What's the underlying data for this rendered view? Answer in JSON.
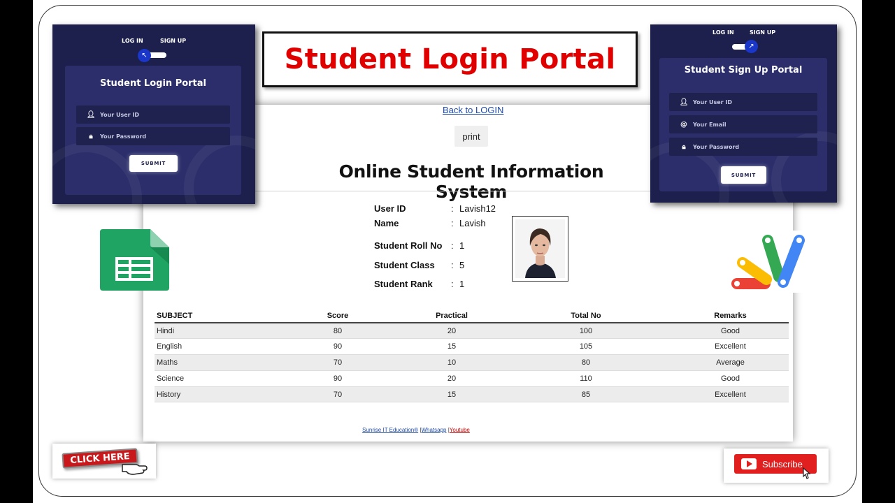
{
  "banner": {
    "title": "Student Login Portal"
  },
  "page": {
    "back_link": "Back to LOGIN",
    "print_label": "print",
    "system_title": "Online Student Information System"
  },
  "student": {
    "fields": [
      {
        "label": "User ID",
        "value": "Lavish12"
      },
      {
        "label": "Name",
        "value": "Lavish"
      },
      {
        "label": "Student Roll No",
        "value": "1"
      },
      {
        "label": "Student Class",
        "value": "5"
      },
      {
        "label": "Student Rank",
        "value": "1"
      }
    ],
    "colon": ":"
  },
  "grades": {
    "headers": [
      "SUBJECT",
      "Score",
      "Practical",
      "Total No",
      "Remarks"
    ],
    "rows": [
      [
        "Hindi",
        "80",
        "20",
        "100",
        "Good"
      ],
      [
        "English",
        "90",
        "15",
        "105",
        "Excellent"
      ],
      [
        "Maths",
        "70",
        "10",
        "80",
        "Average"
      ],
      [
        "Science",
        "90",
        "20",
        "110",
        "Good"
      ],
      [
        "History",
        "70",
        "15",
        "85",
        "Excellent"
      ]
    ]
  },
  "footer": {
    "link1": "Sunrise IT Education®",
    "link2": "Whatsapp",
    "link3": "Youtube",
    "sep": "|"
  },
  "login_card": {
    "tab_login": "LOG IN",
    "tab_signup": "SIGN UP",
    "title": "Student Login Portal",
    "user_placeholder": "Your User ID",
    "password_placeholder": "Your Password",
    "submit": "SUBMIT",
    "knob_arrow": "↖"
  },
  "signup_card": {
    "tab_login": "LOG IN",
    "tab_signup": "SIGN UP",
    "title": "Student Sign Up Portal",
    "user_placeholder": "Your User ID",
    "email_placeholder": "Your Email",
    "password_placeholder": "Your Password",
    "submit": "SUBMIT",
    "knob_arrow": "↗"
  },
  "promo": {
    "click_here": "CLICK HERE",
    "subscribe": "Subscribe"
  },
  "colors": {
    "banner_text": "#e00000",
    "card_bg": "#1d1f4d",
    "accent": "#1a37c9",
    "subscribe": "#e21f1f"
  }
}
